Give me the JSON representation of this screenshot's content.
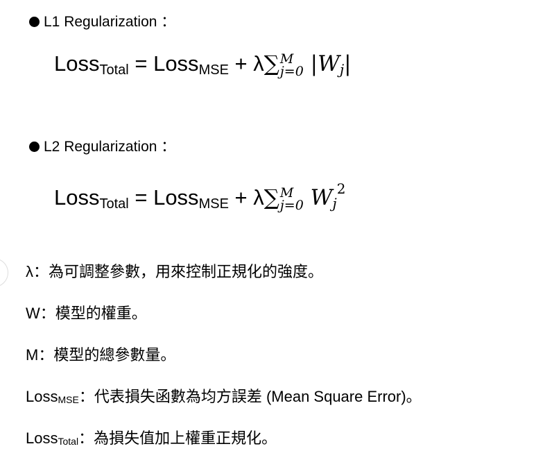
{
  "sections": [
    {
      "bullet": "L1 Regularization ：",
      "lhs_base": "Loss",
      "lhs_sub": "Total",
      "eq": " = ",
      "mse_base": "Loss",
      "mse_sub": "MSE",
      "plus": " + λ",
      "sum": "∑",
      "upper": "M",
      "lower": "j=0",
      "term": " |W",
      "term_sub": "j",
      "term_end": "|",
      "power": ""
    },
    {
      "bullet": "L2 Regularization ：",
      "lhs_base": "Loss",
      "lhs_sub": "Total",
      "eq": " = ",
      "mse_base": "Loss",
      "mse_sub": "MSE",
      "plus": " + λ",
      "sum": "∑",
      "upper": "M",
      "lower": "j=0",
      "term": " W",
      "term_sub": "j",
      "term_end": "",
      "power": "2"
    }
  ],
  "definitions": [
    {
      "base": "λ",
      "sub": "",
      "text": "：為可調整參數，用來控制正規化的強度。"
    },
    {
      "base": "W",
      "sub": "",
      "text": "：模型的權重。"
    },
    {
      "base": "M",
      "sub": "",
      "text": "：模型的總參數量。"
    },
    {
      "base": "Loss",
      "sub": "MSE",
      "text": "：代表損失函數為均方誤差  (Mean Square Error)。"
    },
    {
      "base": "Loss",
      "sub": "Total",
      "text": "：為損失值加上權重正規化。"
    }
  ]
}
